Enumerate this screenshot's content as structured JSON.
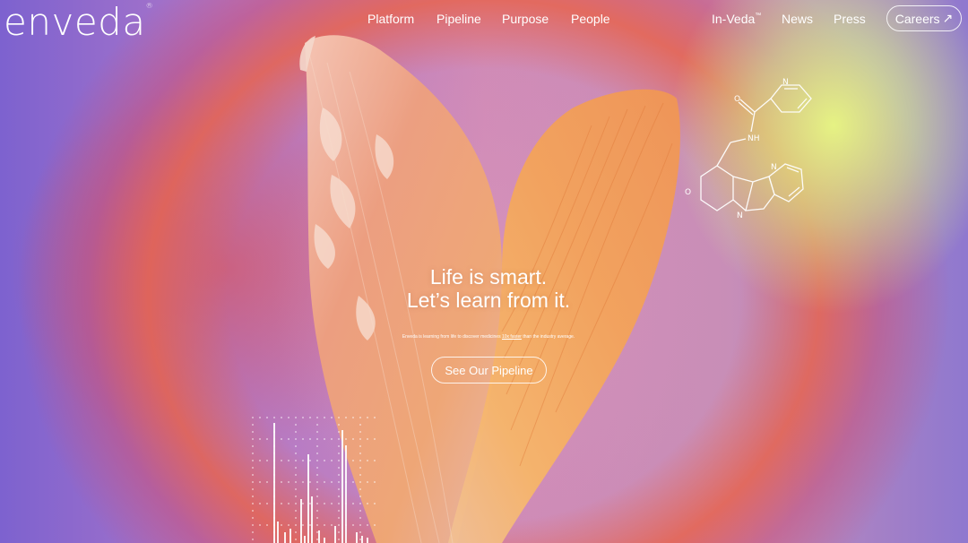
{
  "brand": {
    "logo_text": "enveda",
    "logo_mark": "®"
  },
  "nav": {
    "center": [
      "Platform",
      "Pipeline",
      "Purpose",
      "People"
    ],
    "inveda": "In-Veda",
    "inveda_mark": "™",
    "news": "News",
    "press": "Press",
    "careers": "Careers",
    "careers_icon": "↗"
  },
  "hero": {
    "title_line1": "Life is smart.",
    "title_line2": "Let’s learn from it.",
    "subtitle_before": "Enveda is learning from life to discover medicines ",
    "subtitle_link": "10x faster",
    "subtitle_after": " than the industry average.",
    "cta": "See Our Pipeline"
  },
  "molecule": {
    "labels": [
      "O",
      "NH",
      "N",
      "N",
      "N",
      "O"
    ]
  },
  "colors": {
    "accent_lime": "#e8fa82",
    "accent_coral": "#e6644f",
    "purple": "#7d62cf",
    "petal_orange": "#f2a25a"
  }
}
